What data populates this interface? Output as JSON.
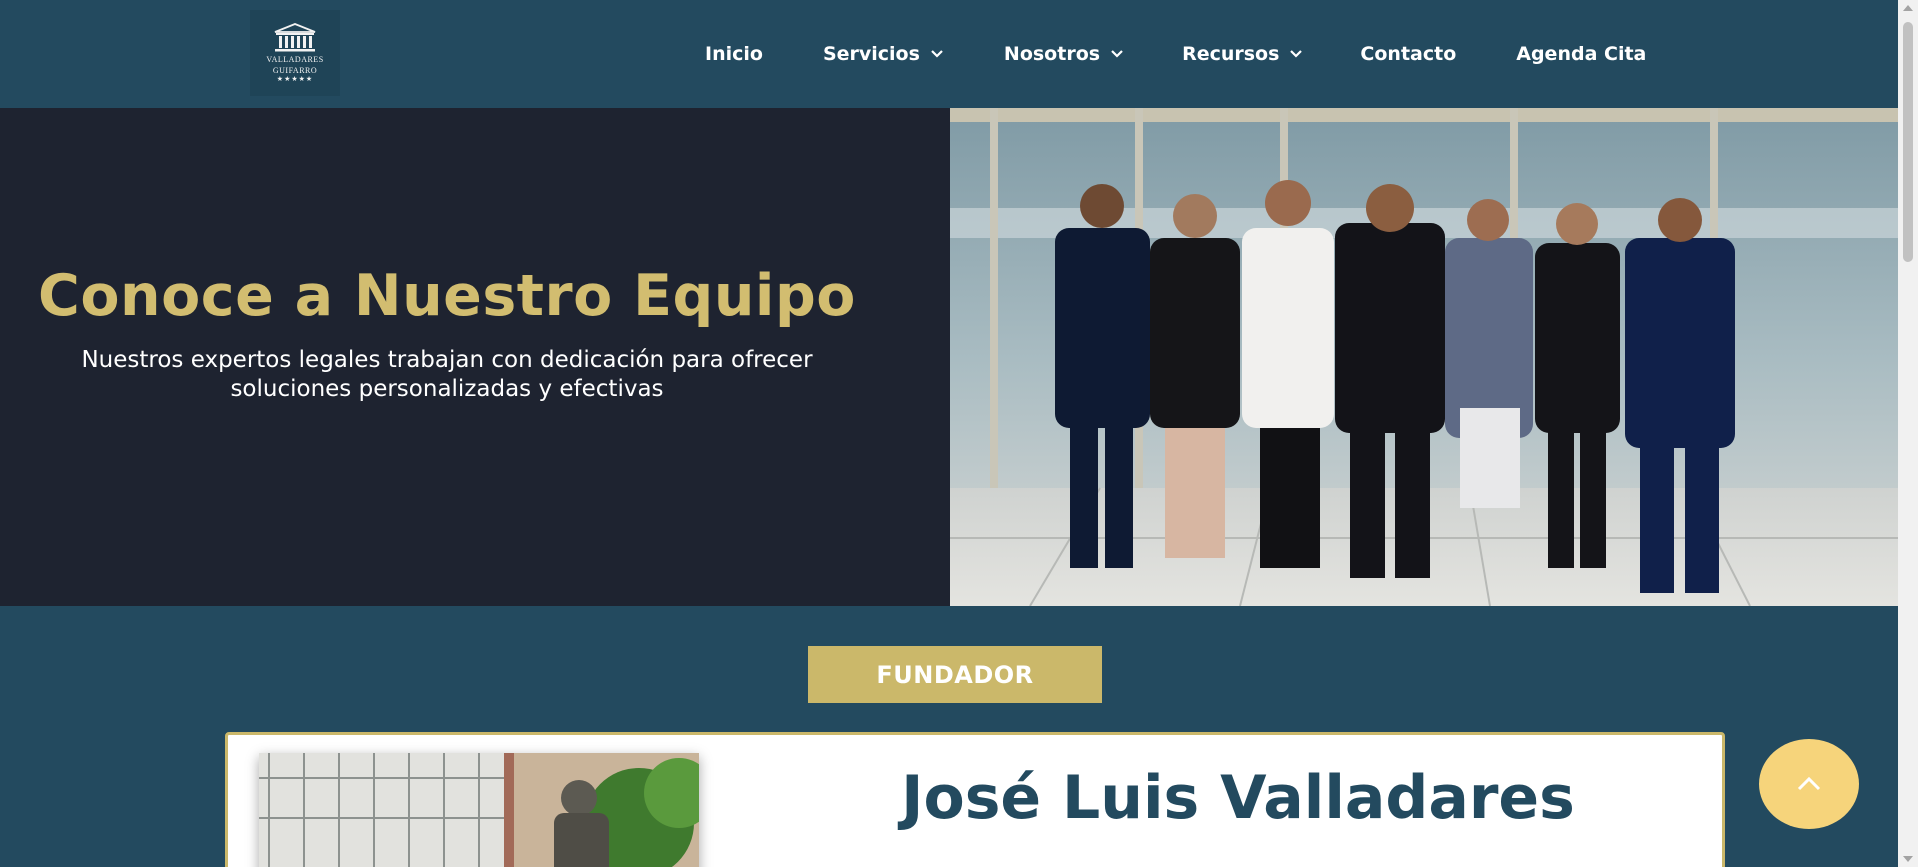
{
  "brand": {
    "logo_text_line1": "VALLADARES",
    "logo_text_line2": "GUIFARRO",
    "logo_stars": "★★★★★"
  },
  "nav": {
    "items": [
      {
        "label": "Inicio",
        "has_dropdown": false
      },
      {
        "label": "Servicios",
        "has_dropdown": true
      },
      {
        "label": "Nosotros",
        "has_dropdown": true
      },
      {
        "label": "Recursos",
        "has_dropdown": true
      },
      {
        "label": "Contacto",
        "has_dropdown": false
      },
      {
        "label": "Agenda Cita",
        "has_dropdown": false
      }
    ]
  },
  "hero": {
    "title": "Conoce a Nuestro Equipo",
    "subtitle": "Nuestros expertos legales trabajan con dedicación para ofrecer soluciones personalizadas y efectivas"
  },
  "founder": {
    "badge": "FUNDADOR",
    "name": "José Luis Valladares"
  },
  "colors": {
    "header_bg": "#234a5f",
    "hero_bg": "#1e2330",
    "gold": "#d2bd70",
    "badge_gold": "#cbb86a",
    "back_to_top": "#f6d47b"
  },
  "icons": {
    "logo": "courthouse-icon",
    "dropdown": "chevron-down-icon",
    "back_to_top": "chevron-up-icon"
  }
}
